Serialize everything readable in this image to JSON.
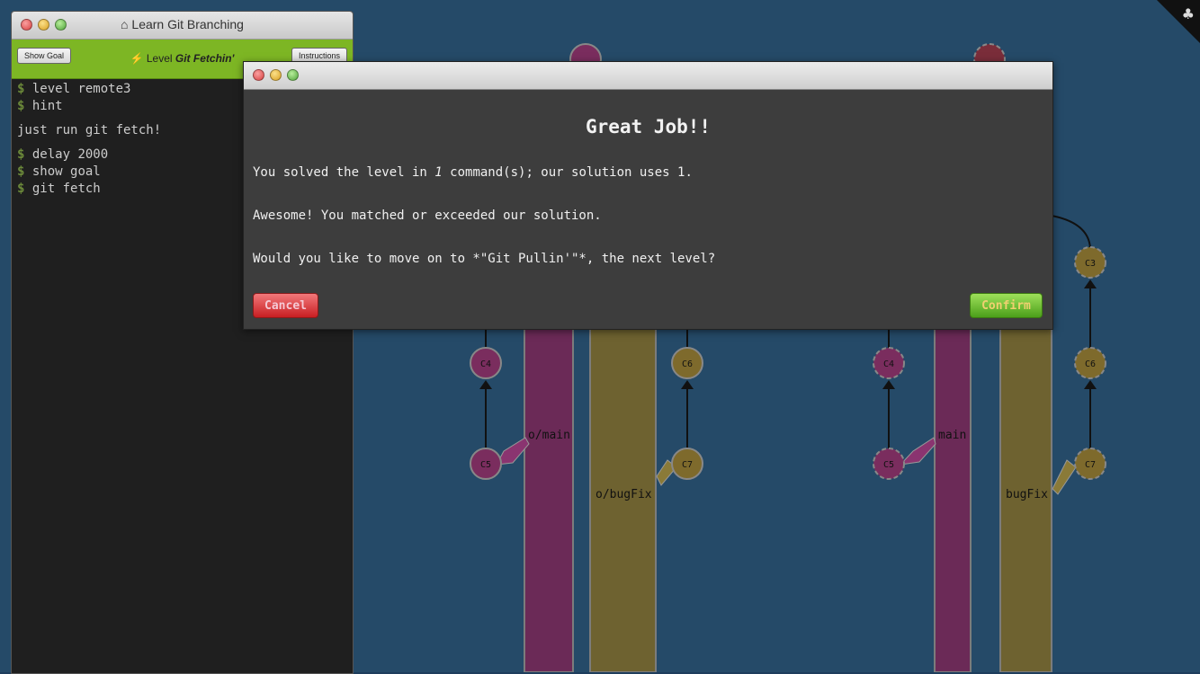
{
  "terminal": {
    "title": "Learn Git Branching",
    "show_goal_label": "Show Goal",
    "instructions_label": "Instructions",
    "level_prefix": "Level",
    "level_name": "Git Fetchin'",
    "lines": [
      {
        "prompt": "$",
        "text": " level remote3"
      },
      {
        "prompt": "$",
        "text": " hint"
      },
      {
        "prompt": "",
        "text": "just run git fetch!"
      },
      {
        "prompt": "$",
        "text": " delay 2000"
      },
      {
        "prompt": "$",
        "text": " show goal"
      },
      {
        "prompt": "$",
        "text": " git fetch"
      }
    ]
  },
  "dialog": {
    "heading": "Great Job!!",
    "line1_pre": "You solved the level in ",
    "line1_count": "1",
    "line1_post": " command(s); our solution uses 1.",
    "line2": "Awesome! You matched or exceeded our solution.",
    "line3": "Would you like to move on to *\"Git Pullin'\"*, the next level?",
    "cancel_label": "Cancel",
    "confirm_label": "Confirm"
  },
  "graph": {
    "commits": [
      "C0",
      "C0",
      "C3",
      "C4",
      "C6",
      "C5",
      "C7",
      "C4",
      "C6",
      "C5",
      "C7"
    ],
    "branches": [
      "o/main",
      "o/bugFix",
      "main",
      "bugFix"
    ]
  },
  "colors": {
    "main_branch": "#6b2a57",
    "bugfix_branch": "#6e6230",
    "commit_main": "#7a2d5e",
    "commit_bugfix": "#7e6a2c"
  }
}
